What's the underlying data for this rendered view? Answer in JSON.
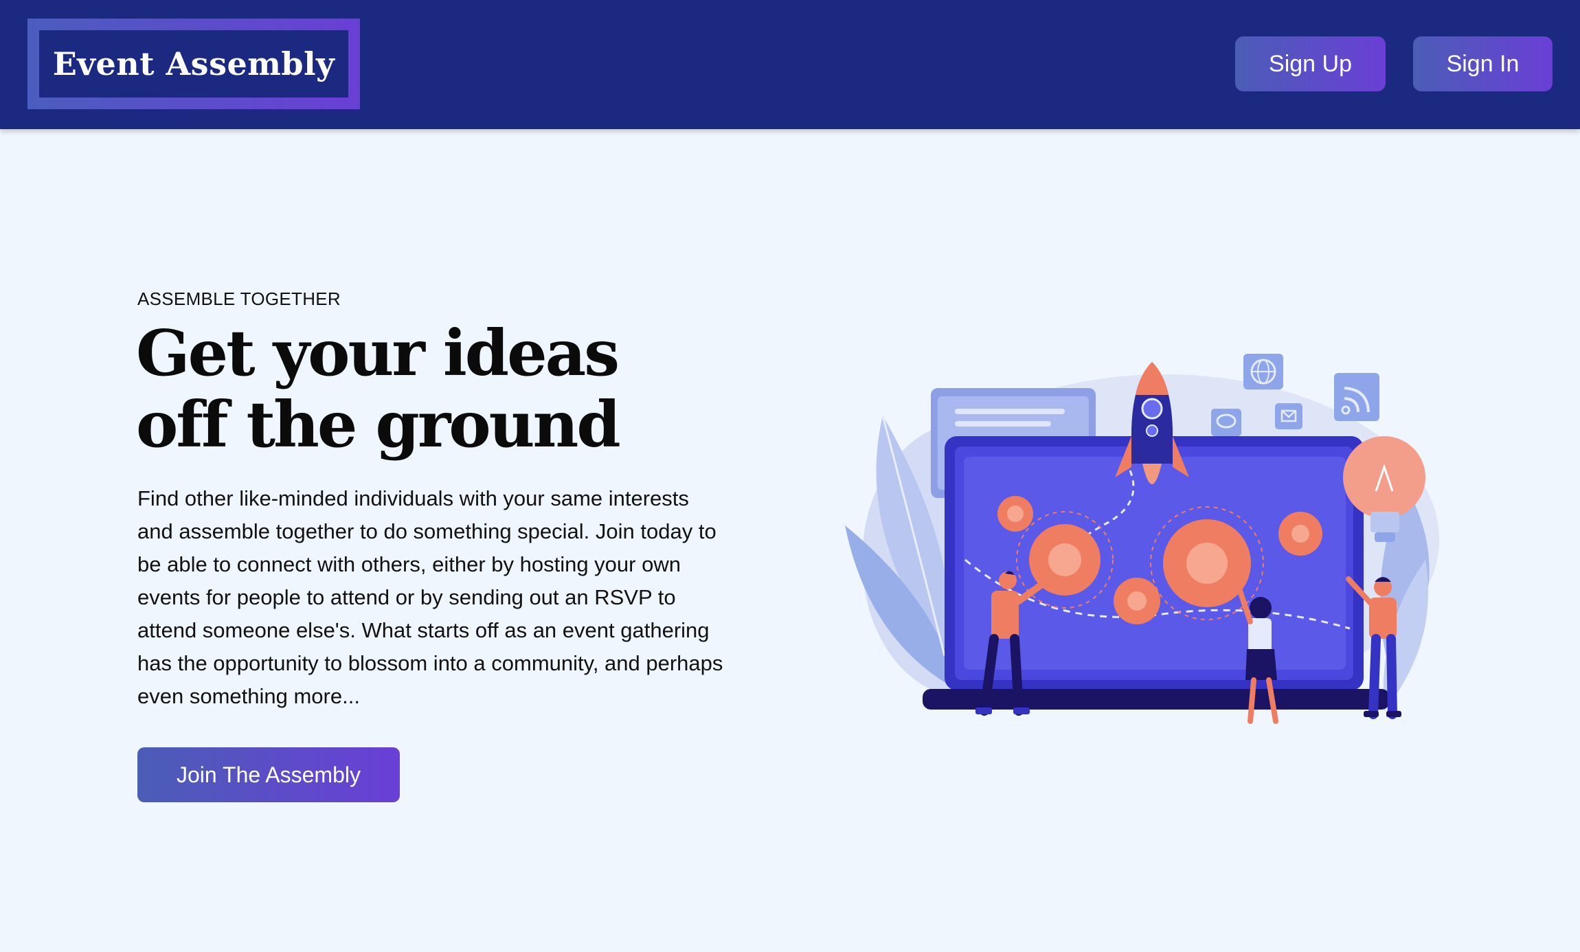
{
  "header": {
    "logo_text": "Event Assembly",
    "sign_up_label": "Sign Up",
    "sign_in_label": "Sign In"
  },
  "hero": {
    "eyebrow": "ASSEMBLE TOGETHER",
    "headline_line1": "Get your ideas",
    "headline_line2": "off the ground",
    "body": "Find other like-minded individuals with your same interests and assemble together to do something special. Join today to be able to connect with others, either by hosting your own events for people to attend or by sending out an RSVP to attend someone else's. What starts off as an event gathering has the opportunity to blossom into a community, and perhaps even something more...",
    "cta_label": "Join The Assembly",
    "illustration_icon": "teamwork-laptop-gears-rocket-illustration"
  },
  "colors": {
    "navbar_bg": "#1b2a80",
    "page_bg": "#f0f6fd",
    "gradient_start": "#4b5db6",
    "gradient_end": "#6a3fd6",
    "accent_orange": "#ee7d62"
  }
}
